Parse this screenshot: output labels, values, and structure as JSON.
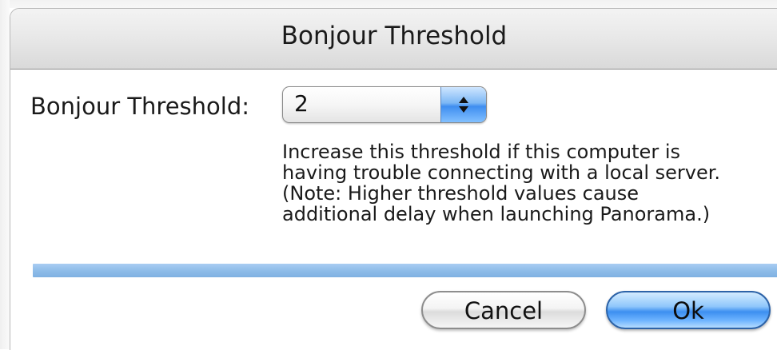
{
  "dialog": {
    "title": "Bonjour Threshold"
  },
  "threshold": {
    "label": "Bonjour Threshold:",
    "selected_value": "2"
  },
  "help": {
    "lines": [
      "Increase this threshold if this computer is",
      "having trouble connecting with a local server.",
      "(Note: Higher threshold values cause",
      "additional delay when launching Panorama.)"
    ]
  },
  "buttons": {
    "cancel_label": "Cancel",
    "ok_label": "Ok"
  },
  "colors": {
    "accent": "#3c8ff0",
    "separator": "#8fbde9"
  },
  "icons": {
    "popup_arrows": "up-down-arrows-icon"
  }
}
